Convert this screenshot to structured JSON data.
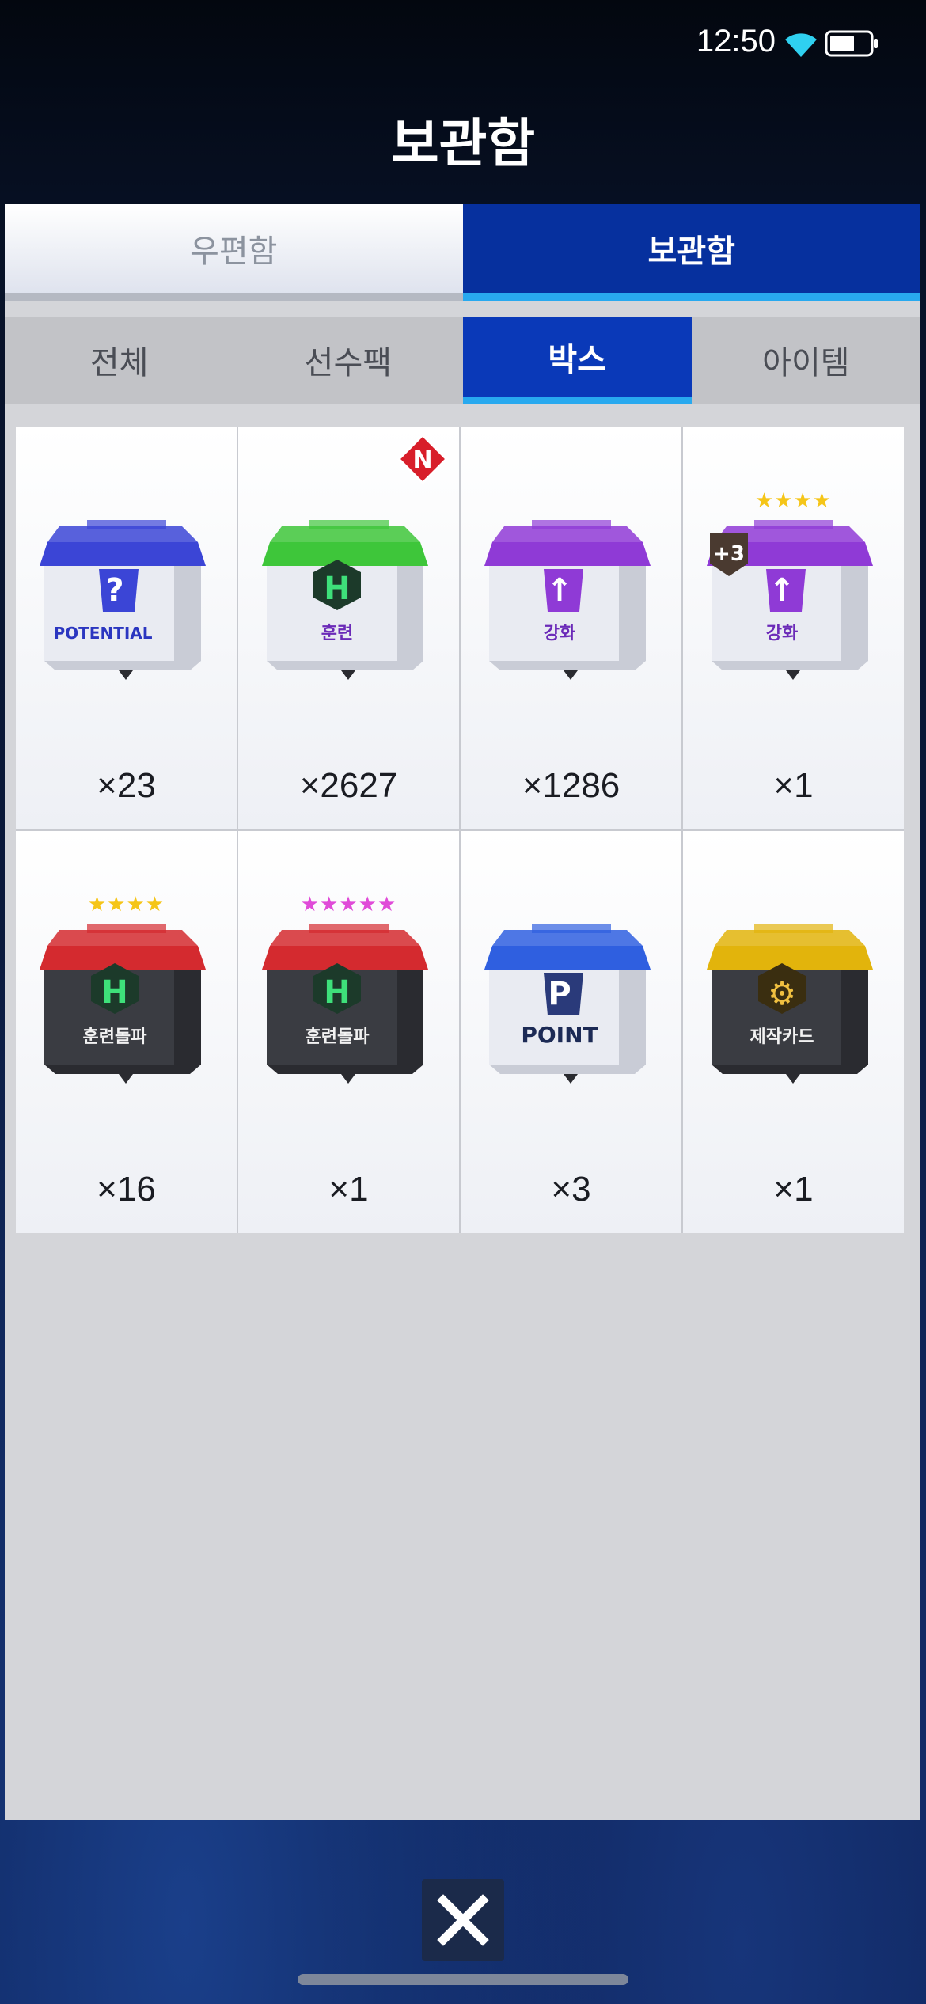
{
  "status": {
    "time": "12:50"
  },
  "title": "보관함",
  "top_tabs": [
    {
      "label": "우편함",
      "active": false
    },
    {
      "label": "보관함",
      "active": true
    }
  ],
  "sub_tabs": [
    {
      "label": "전체",
      "active": false
    },
    {
      "label": "선수팩",
      "active": false
    },
    {
      "label": "박스",
      "active": true
    },
    {
      "label": "아이템",
      "active": false
    }
  ],
  "items": [
    {
      "lid": "#3b45d6",
      "emblem": "?",
      "label": "POTENTIAL",
      "count": "×23",
      "new": false
    },
    {
      "lid": "#3ec63a",
      "emblem": "H",
      "label": "훈련",
      "count": "×2627",
      "new": true,
      "new_label": "N"
    },
    {
      "lid": "#8f3ad6",
      "emblem": "↑",
      "label": "강화",
      "count": "×1286",
      "new": false
    },
    {
      "lid": "#8f3ad6",
      "emblem": "↑",
      "label": "강화",
      "count": "×1",
      "new": false,
      "plus": "+3",
      "stars": "★★★★"
    },
    {
      "lid": "#d42a2f",
      "emblem": "H",
      "label": "훈련돌파",
      "count": "×16",
      "new": false,
      "dark": true,
      "stars": "★★★★"
    },
    {
      "lid": "#d42a2f",
      "emblem": "H",
      "label": "훈련돌파",
      "count": "×1",
      "new": false,
      "dark": true,
      "stars": "★★★★★",
      "star_color": "#e04bd8"
    },
    {
      "lid": "#2f5fe0",
      "emblem": "P",
      "label": "POINT",
      "count": "×3",
      "new": false
    },
    {
      "lid": "#e2b40c",
      "emblem": "⚙",
      "label": "제작카드",
      "count": "×1",
      "new": false,
      "dark": true
    }
  ],
  "colors": {
    "accent": "#06309e",
    "highlight": "#28a9ef"
  }
}
